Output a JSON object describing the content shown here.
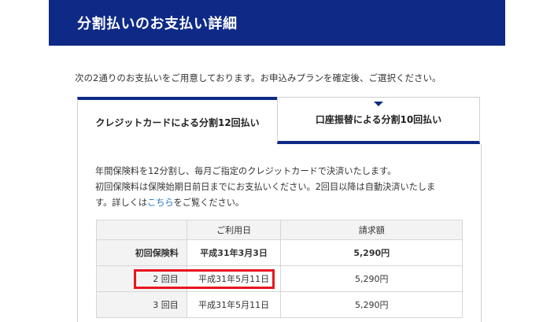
{
  "header": {
    "title": "分割払いのお支払い詳細"
  },
  "intro": "次の2通りのお支払いをご用意しております。お申込みプランを確定後、ご選択ください。",
  "tabs": [
    {
      "label": "クレジットカードによる分割12回払い",
      "active": true
    },
    {
      "label": "口座振替による分割10回払い",
      "active": false
    }
  ],
  "panel": {
    "desc_line1": "年間保険料を12分割し、毎月ご指定のクレジットカードで決済いたします。",
    "desc_line2": "初回保険料は保険始期日前日までにお支払いください。2回目以降は自動決済いたしま",
    "desc_line3_pre": "す。詳しくは",
    "desc_link": "こちら",
    "desc_line3_post": "をご覧ください。"
  },
  "table": {
    "headers": [
      "",
      "ご利用日",
      "請求額"
    ],
    "rows": [
      {
        "label": "初回保険料",
        "date": "平成31年3月3日",
        "amount": "5,290円"
      },
      {
        "label": "2 回目",
        "date": "平成31年5月11日",
        "amount": "5,290円"
      },
      {
        "label": "3 回目",
        "date": "平成31年5月11日",
        "amount": "5,290円"
      }
    ]
  },
  "colors": {
    "brand_navy": "#0e2a86",
    "highlight_red": "#e8141f",
    "link_blue": "#1a73c8"
  }
}
